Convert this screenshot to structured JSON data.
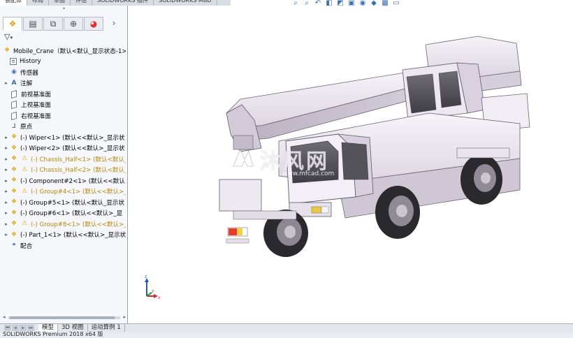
{
  "command_tabs": [
    "装配体",
    "布局",
    "草图",
    "评估",
    "SOLIDWORKS 插件",
    "SOLIDWORKS MBD"
  ],
  "view_toolbar": [
    "search-zoom-icon",
    "zoom-area-icon",
    "previous-view-icon",
    "section-view-icon",
    "view-orientation-icon",
    "display-style-icon",
    "hide-show-icon",
    "appearance-icon",
    "scene-icon",
    "display-settings-icon"
  ],
  "panel": {
    "tabs": [
      "featuremanager-icon",
      "propertymanager-icon",
      "configurationmanager-icon",
      "dimxpert-icon",
      "display-manager-icon"
    ],
    "more": "›",
    "filter_glyph": "▽"
  },
  "tree": {
    "root": "Mobile_Crane（默认<默认_显示状态-1>",
    "items": [
      {
        "label": "History",
        "icon": "history-icon",
        "warn": false,
        "expand": ""
      },
      {
        "label": "传感器",
        "icon": "sensor-icon",
        "warn": false,
        "expand": ""
      },
      {
        "label": "注解",
        "icon": "annotation-icon",
        "warn": false,
        "expand": "▸"
      },
      {
        "label": "前视基准面",
        "icon": "plane-icon",
        "warn": false,
        "expand": ""
      },
      {
        "label": "上视基准面",
        "icon": "plane-icon",
        "warn": false,
        "expand": ""
      },
      {
        "label": "右视基准面",
        "icon": "plane-icon",
        "warn": false,
        "expand": ""
      },
      {
        "label": "原点",
        "icon": "origin-icon",
        "warn": false,
        "expand": ""
      },
      {
        "label": "(-) Wiper<1> (默认<<默认>_显示状",
        "icon": "part-icon",
        "warn": false,
        "expand": "▸"
      },
      {
        "label": "(-) Wiper<2> (默认<<默认>_显示状",
        "icon": "part-icon",
        "warn": false,
        "expand": "▸"
      },
      {
        "label": "(-) Chassis_Half<1> (默认<默认_",
        "icon": "part-icon",
        "warn": true,
        "expand": "▸"
      },
      {
        "label": "(-) Chassis_Half<2> (默认<默认_",
        "icon": "part-icon",
        "warn": true,
        "expand": "▸"
      },
      {
        "label": "(-) Component#2<1> (默认<<默认",
        "icon": "part-icon",
        "warn": false,
        "expand": "▸"
      },
      {
        "label": "(-) Group#4<1> (默认<<默认>_显",
        "icon": "part-icon",
        "warn": true,
        "expand": "▸"
      },
      {
        "label": "(-) Group#5<1> (默认<默认_显示状",
        "icon": "part-icon",
        "warn": false,
        "expand": "▸"
      },
      {
        "label": "(-) Group#6<1> (默认<<默认>_显",
        "icon": "part-icon",
        "warn": false,
        "expand": "▸"
      },
      {
        "label": "(-) Group#8<1> (默认<<默认>_显",
        "icon": "part-icon",
        "warn": true,
        "expand": "▸"
      },
      {
        "label": "(-) Part_1<1> (默认<<默认>_显示状",
        "icon": "part-icon",
        "warn": false,
        "expand": "▸"
      },
      {
        "label": "配合",
        "icon": "mates-icon",
        "warn": false,
        "expand": ""
      }
    ]
  },
  "bottom_tabs": [
    "模型",
    "3D 视图",
    "运动算例 1"
  ],
  "status": "SOLIDWORKS Premium 2018 x64 版",
  "watermark": {
    "text": "沐风网",
    "url": "www.mfcad.com"
  },
  "triad": {
    "x": "x",
    "y": "y",
    "z": "z"
  },
  "colors": {
    "accent": "#3a6fb0",
    "warning": "#e0a400",
    "model": "#e9e3ee"
  }
}
